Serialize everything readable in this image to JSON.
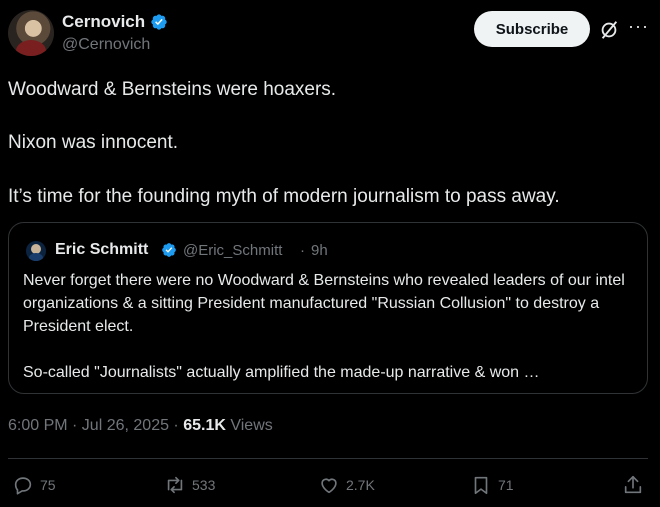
{
  "author": {
    "name": "Cernovich",
    "handle": "@Cernovich"
  },
  "header": {
    "subscribe_label": "Subscribe"
  },
  "tweet": {
    "paragraphs": [
      "Woodward & Bernsteins were hoaxers.",
      "Nixon was innocent.",
      "It’s time for the founding myth of modern journalism to pass away."
    ]
  },
  "quote": {
    "name": "Eric Schmitt",
    "handle": "@Eric_Schmitt",
    "separator": "·",
    "time": "9h",
    "paragraph1": "Never forget there were no Woodward & Bernsteins who revealed leaders of our intel organizations & a sitting President manufactured \"Russian Collusion\" to destroy a President elect.",
    "paragraph2": "So-called \"Journalists\" actually amplified the made-up narrative & won …"
  },
  "meta": {
    "timestamp": "6:00 PM · Jul 26, 2025 · ",
    "views_count": "65.1K",
    "views_label": "Views"
  },
  "actions": {
    "replies": "75",
    "reposts": "533",
    "likes": "2.7K",
    "bookmarks": "71"
  },
  "icons": {
    "verified": "verified-badge-icon",
    "grok": "grok-icon",
    "more": "more-icon",
    "reply": "reply-icon",
    "repost": "repost-icon",
    "like": "like-icon",
    "bookmark": "bookmark-icon",
    "share": "share-icon"
  },
  "colors": {
    "background": "#000000",
    "text": "#e7e9ea",
    "muted": "#71767b",
    "verified": "#1d9bf0",
    "border": "#2f3336"
  }
}
